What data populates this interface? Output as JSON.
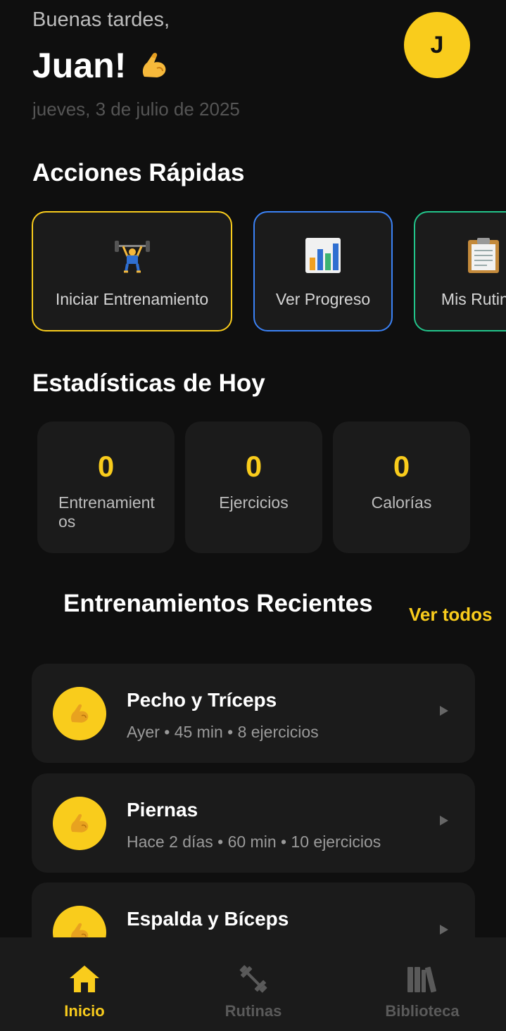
{
  "header": {
    "greeting": "Buenas tardes,",
    "name": "Juan!",
    "date": "jueves, 3 de julio de 2025",
    "avatar_initial": "J"
  },
  "quick_actions": {
    "title": "Acciones Rápidas",
    "items": [
      {
        "label": "Iniciar Entrenamiento",
        "icon": "weightlifter-icon",
        "border_color": "#f9cc1c"
      },
      {
        "label": "Ver Progreso",
        "icon": "bar-chart-icon",
        "border_color": "#3b82f6"
      },
      {
        "label": "Mis Rutinas",
        "icon": "clipboard-icon",
        "border_color": "#22c58b"
      }
    ]
  },
  "stats": {
    "title": "Estadísticas de Hoy",
    "items": [
      {
        "value": "0",
        "label": "Entrenamientos"
      },
      {
        "value": "0",
        "label": "Ejercicios"
      },
      {
        "value": "0",
        "label": "Calorías"
      }
    ]
  },
  "recent": {
    "title": "Entrenamientos Recientes",
    "see_all": "Ver todos",
    "items": [
      {
        "title": "Pecho y Tríceps",
        "meta": "Ayer • 45 min • 8 ejercicios",
        "icon": "muscle-icon"
      },
      {
        "title": "Piernas",
        "meta": "Hace 2 días • 60 min • 10 ejercicios",
        "icon": "muscle-icon"
      },
      {
        "title": "Espalda y Bíceps",
        "meta": "",
        "icon": "muscle-icon"
      }
    ]
  },
  "nav": {
    "items": [
      {
        "label": "Inicio",
        "icon": "home-icon",
        "active": true
      },
      {
        "label": "Rutinas",
        "icon": "dumbbell-icon",
        "active": false
      },
      {
        "label": "Biblioteca",
        "icon": "library-icon",
        "active": false
      }
    ]
  },
  "colors": {
    "accent": "#f9cc1c",
    "background": "#0f0f0f",
    "card": "#1b1b1b"
  }
}
